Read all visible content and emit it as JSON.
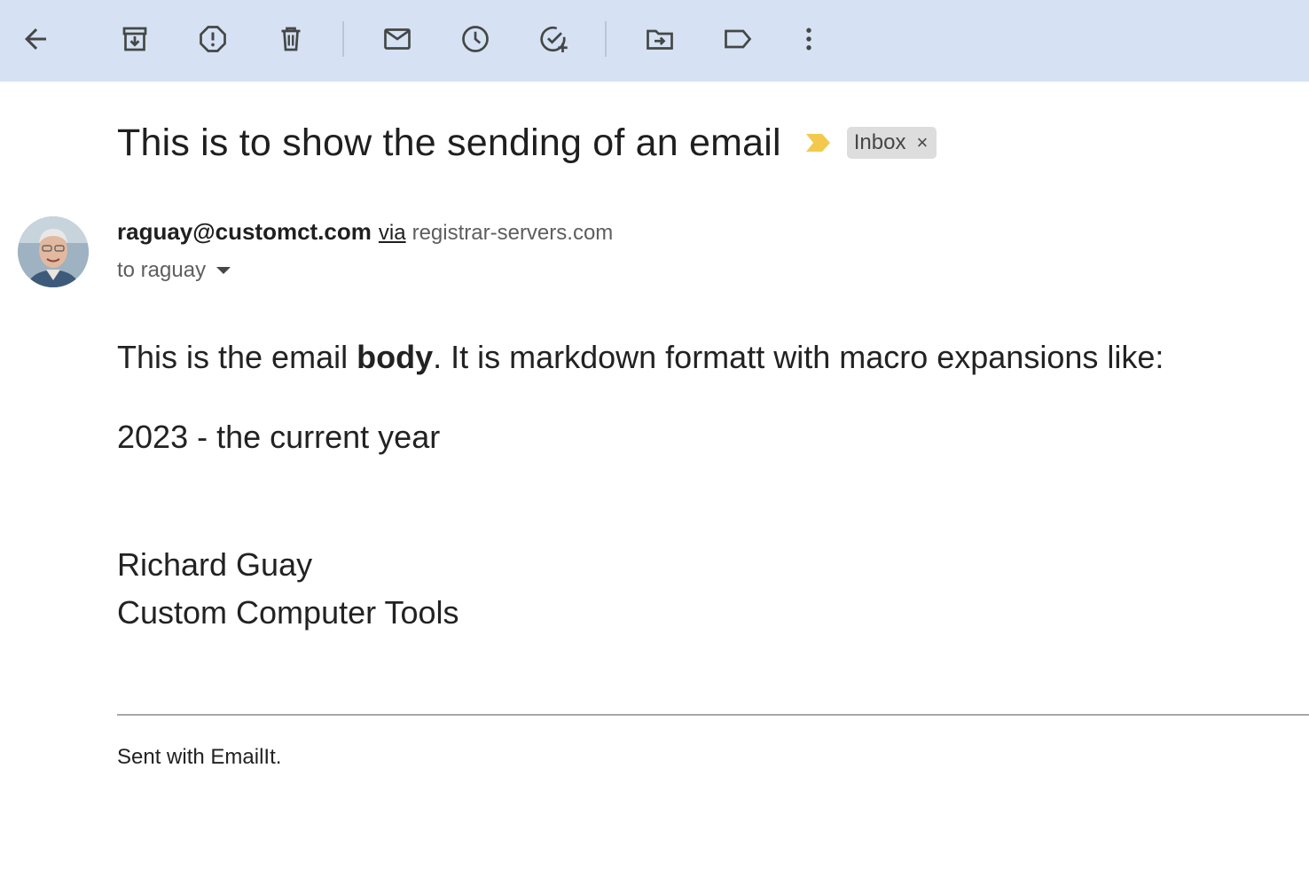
{
  "toolbar": {
    "buttons": [
      {
        "name": "back",
        "icon": "arrow-left-icon"
      },
      {
        "name": "archive",
        "icon": "archive-icon"
      },
      {
        "name": "report-spam",
        "icon": "report-spam-icon"
      },
      {
        "name": "delete",
        "icon": "trash-icon"
      },
      {
        "name": "mark-unread",
        "icon": "envelope-icon"
      },
      {
        "name": "snooze",
        "icon": "clock-icon"
      },
      {
        "name": "add-to-tasks",
        "icon": "add-task-icon"
      },
      {
        "name": "move-to",
        "icon": "move-folder-icon"
      },
      {
        "name": "labels",
        "icon": "label-icon"
      },
      {
        "name": "more",
        "icon": "more-vertical-icon"
      }
    ]
  },
  "message": {
    "subject": "This is to show the sending of an email",
    "label": "Inbox",
    "label_remove": "×",
    "sender_email": "raguay@customct.com",
    "via_text": "via",
    "via_domain": "registrar-servers.com",
    "recipient": "to raguay"
  },
  "body": {
    "line1_before": "This is the email ",
    "line1_bold": "body",
    "line1_after": ". It is markdown formatt with macro expansions like:",
    "line2": "2023 - the current year",
    "signature_name": "Richard Guay",
    "signature_company": "Custom Computer Tools",
    "footer": "Sent with EmailIt."
  },
  "colors": {
    "toolbar_bg": "#d6e2f3",
    "importance_marker": "#f2c94c",
    "label_chip_bg": "#dddddd"
  }
}
